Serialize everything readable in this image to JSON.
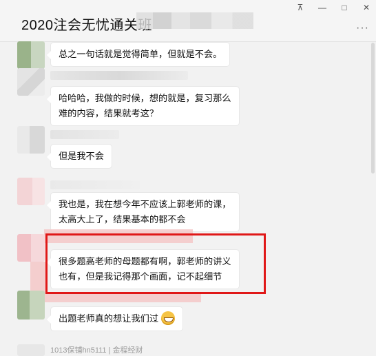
{
  "window": {
    "title": "2020注会无忧通关班",
    "controls": {
      "pin": "⊼",
      "minimize": "—",
      "maximize": "□",
      "close": "✕"
    },
    "more": "···"
  },
  "messages": [
    {
      "text_lines": [
        "总之一句话就是觉得简单，但就是不会。"
      ]
    },
    {
      "text_lines": [
        "哈哈哈，我做的时候，想的就是，复习那么",
        "难的内容，结果就考这？"
      ]
    },
    {
      "text_lines": [
        "但是我不会"
      ]
    },
    {
      "text_lines": [
        "我也是，我在想今年不应该上郭老师的课，",
        "太高大上了，结果基本的都不会"
      ]
    },
    {
      "text_lines": [
        "很多题高老师的母题都有啊，郭老师的讲义",
        "也有，但是我记得那个画面，记不起细节"
      ],
      "highlighted": true
    },
    {
      "text_lines": [
        "出题老师真的想让我们过"
      ],
      "emoji": "grinning-face"
    }
  ],
  "bottom_partial_name": "1013保铺hn5111 | 金程经财",
  "colors": {
    "highlight_border": "#e01818",
    "bubble_bg": "#ffffff",
    "chat_bg": "#f2f2f2"
  }
}
